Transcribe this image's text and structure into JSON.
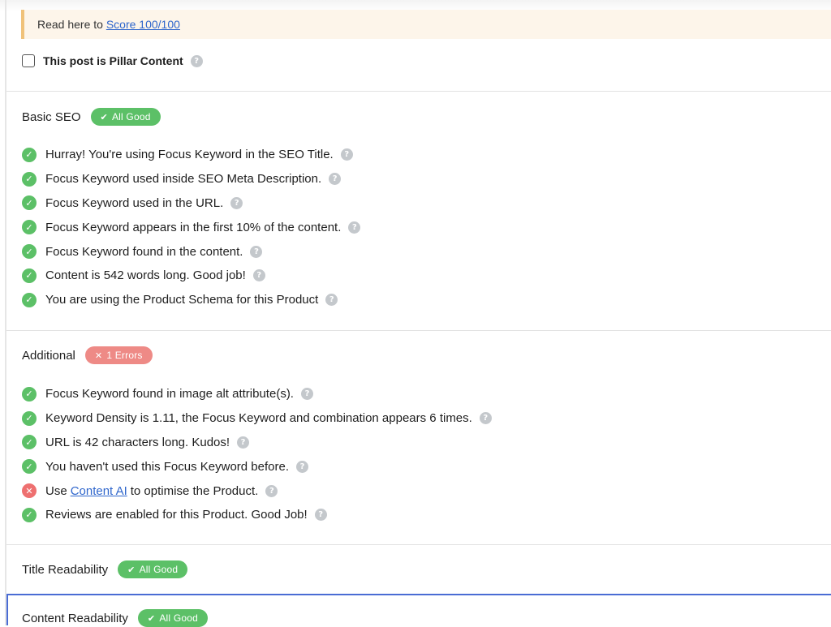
{
  "notice": {
    "prefix": "Read here to",
    "link": "Score 100/100"
  },
  "pillar": {
    "label": "This post is Pillar Content",
    "checked": false
  },
  "sections": [
    {
      "title": "Basic SEO",
      "badge": {
        "type": "good",
        "mark": "✔",
        "text": "All Good"
      },
      "items": [
        {
          "status": "ok",
          "text": "Hurray! You're using Focus Keyword in the SEO Title."
        },
        {
          "status": "ok",
          "text": "Focus Keyword used inside SEO Meta Description."
        },
        {
          "status": "ok",
          "text": "Focus Keyword used in the URL."
        },
        {
          "status": "ok",
          "text": "Focus Keyword appears in the first 10% of the content."
        },
        {
          "status": "ok",
          "text": "Focus Keyword found in the content."
        },
        {
          "status": "ok",
          "text": "Content is 542 words long. Good job!"
        },
        {
          "status": "ok",
          "text": "You are using the Product Schema for this Product"
        }
      ]
    },
    {
      "title": "Additional",
      "badge": {
        "type": "error",
        "mark": "✕",
        "text": "1 Errors"
      },
      "items": [
        {
          "status": "ok",
          "text": "Focus Keyword found in image alt attribute(s)."
        },
        {
          "status": "ok",
          "text": "Keyword Density is 1.11, the Focus Keyword and combination appears 6 times."
        },
        {
          "status": "ok",
          "text": "URL is 42 characters long. Kudos!"
        },
        {
          "status": "ok",
          "text": "You haven't used this Focus Keyword before."
        },
        {
          "status": "fail",
          "prefix": "Use",
          "link": "Content AI",
          "suffix": "to optimise the Product."
        },
        {
          "status": "ok",
          "text": "Reviews are enabled for this Product. Good Job!"
        }
      ]
    },
    {
      "title": "Title Readability",
      "badge": {
        "type": "good",
        "mark": "✔",
        "text": "All Good"
      }
    },
    {
      "title": "Content Readability",
      "badge": {
        "type": "good",
        "mark": "✔",
        "text": "All Good"
      }
    }
  ],
  "icons": {
    "ok": "check-circle-icon",
    "fail": "x-circle-icon",
    "help": "help-icon"
  },
  "colors": {
    "good": "#5cc067",
    "error": "#ee8a86",
    "link": "#2f66cc",
    "notice_border": "#f0c27a",
    "active_border": "#4a6cd4"
  }
}
